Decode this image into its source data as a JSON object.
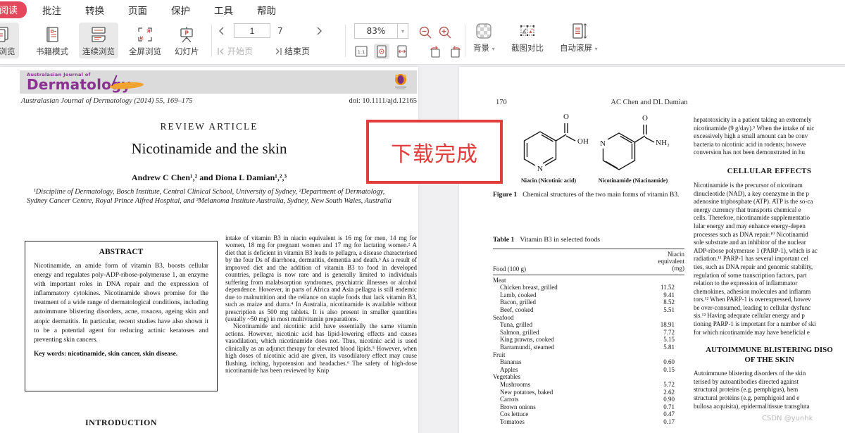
{
  "menu": {
    "active_tab": "阅读",
    "items": [
      "批注",
      "转换",
      "页面",
      "保护",
      "工具",
      "帮助"
    ]
  },
  "toolbar": {
    "view_buttons": [
      {
        "label": "页浏览"
      },
      {
        "label": "书籍模式"
      },
      {
        "label": "连续浏览"
      },
      {
        "label": "全屏浏览"
      },
      {
        "label": "幻灯片"
      }
    ],
    "nav": {
      "current_page": "1",
      "total_pages": "7",
      "start_label": "开始页",
      "end_label": "结束页"
    },
    "zoom": {
      "level": "83%",
      "one_to_one": "1:1"
    },
    "background_label": "背景",
    "compare_label": "截图对比",
    "autoscroll_label": "自动滚屏"
  },
  "overlay": {
    "text": "下载完成"
  },
  "left_page": {
    "banner": {
      "small": "Australasian Journal of",
      "name": "Dermatology"
    },
    "citation": "Australasian Journal of Dermatology (2014) 55, 169–175",
    "doi": "doi: 10.1111/ajd.12165",
    "article_type": "REVIEW ARTICLE",
    "title": "Nicotinamide and the skin",
    "authors": "Andrew C Chen¹,² and Diona L Damian¹,²,³",
    "affiliations": "¹Discipline of Dermatology, Bosch Institute, Central Clinical School, University of Sydney, ²Department of Dermatology, Sydney Cancer Centre, Royal Prince Alfred Hospital, and ³Melanoma Institute Australia, Sydney, New South Wales, Australia",
    "abstract": {
      "heading": "ABSTRACT",
      "text": "Nicotinamide, an amide form of vitamin B3, boosts cellular energy and regulates poly-ADP-ribose-polymerase 1, an enzyme with important roles in DNA repair and the expression of inflammatory cytokines. Nicotinamide shows promise for the treatment of a wide range of dermatological conditions, including autoimmune blistering disorders, acne, rosacea, ageing skin and atopic dermatitis. In particular, recent studies have also shown it to be a potential agent for reducing actinic keratoses and preventing skin cancers.",
      "keywords": "Key words: nicotinamide, skin cancer, skin disease."
    },
    "intro_heading": "INTRODUCTION",
    "col2_para1": "intake of vitamin B3 in niacin equivalent is 16 mg for men, 14 mg for women, 18 mg for pregnant women and 17 mg for lactating women.² A diet that is deficient in vitamin B3 leads to pellagra, a disease characterised by the four Ds of diarrhoea, dermatitis, dementia and death.³ As a result of improved diet and the addition of vitamin B3 to food in developed countries, pellagra is now rare and is generally limited to individuals suffering from malabsorption syndromes, psychiatric illnesses or alcohol dependence. However, in parts of Africa and Asia pellagra is still endemic due to malnutrition and the reliance on staple foods that lack vitamin B3, such as maize and durra.⁴ In Australia, nicotinamide is available without prescription as 500 mg tablets. It is also present in smaller quantities (usually ~50 mg) in most multivitamin preparations.",
    "col2_para2": "Nicotinamide and nicotinic acid have essentially the same vitamin actions. However, nicotinic acid has lipid-lowering effects and causes vasodilation, which nicotinamide does not. Thus, nicotinic acid is used clinically as an adjunct therapy for elevated blood lipids.⁵ However, when high doses of nicotinic acid are given, its vasodilatory effect may cause flushing, itching, hypotension and headaches.⁶ The safety of high-dose nicotinamide has been reviewed by Knip"
  },
  "right_page": {
    "page_number": "170",
    "running_head": "AC Chen and DL Damian",
    "figure": {
      "atoms": {
        "o1": "O",
        "oh": "OH",
        "n1": "N",
        "o2": "O",
        "nh2": "NH₂",
        "n2": "N"
      },
      "mol1_label": "Niacin (Nicotinic acid)",
      "mol2_label": "Nicotinamide (Niacinamide)",
      "caption_label": "Figure 1",
      "caption_text": "Chemical structures of the two main forms of vitamin B3."
    },
    "table": {
      "label": "Table 1",
      "title": "Vitamin B3 in selected foods",
      "col_food": "Food (100 g)",
      "col_value_l1": "Niacin",
      "col_value_l2": "equivalent",
      "col_value_l3": "(mg)",
      "rows": [
        {
          "name": "Meat",
          "value": "",
          "group": true
        },
        {
          "name": "Chicken breast, grilled",
          "value": "11.52"
        },
        {
          "name": "Lamb, cooked",
          "value": "9.41"
        },
        {
          "name": "Bacon, grilled",
          "value": "8.52"
        },
        {
          "name": "Beef, cooked",
          "value": "5.51"
        },
        {
          "name": "Seafood",
          "value": "",
          "group": true
        },
        {
          "name": "Tuna, grilled",
          "value": "18.91"
        },
        {
          "name": "Salmon, grilled",
          "value": "7.72"
        },
        {
          "name": "King prawns, cooked",
          "value": "5.15"
        },
        {
          "name": "Barramundi, steamed",
          "value": "5.81"
        },
        {
          "name": "Fruit",
          "value": "",
          "group": true
        },
        {
          "name": "Bananas",
          "value": "0.60"
        },
        {
          "name": "Apples",
          "value": "0.15"
        },
        {
          "name": "Vegetables",
          "value": "",
          "group": true
        },
        {
          "name": "Mushrooms",
          "value": "5.72"
        },
        {
          "name": "New potatoes, baked",
          "value": "2.62"
        },
        {
          "name": "Carrots",
          "value": "0.90"
        },
        {
          "name": "Brown onions",
          "value": "0.71"
        },
        {
          "name": "Cos lettuce",
          "value": "0.47"
        },
        {
          "name": "Tomatoes",
          "value": "0.17"
        }
      ]
    },
    "col2": {
      "para1_lines": [
        "hepatotoxicity in a patient taking an extremely",
        "nicotinamide (9 g/day).⁹ When the intake of nic",
        "excessively high a small amount can be conv",
        "bacteria to nicotinic acid in rodents; howeve",
        "conversion has not been demonstrated in hu"
      ],
      "heading1": "CELLULAR EFFECTS",
      "para2_lines": [
        "Nicotinamide is the precursor of nicotinam",
        "dinucleotide (NAD), a key coenzyme in the p",
        "adenosine triphosphate (ATP). ATP is the so-ca",
        "energy currency that transports chemical e",
        "cells. Therefore, nicotinamide supplementatio",
        "lular energy and may enhance energy-depen",
        "processes such as DNA repair.¹⁰ Nicotinamid",
        "sole substrate and an inhibitor of the nuclear",
        "ADP-ribose polymerase 1 (PARP-1), which is ac",
        "radiation.¹¹ PARP-1 has several important cel",
        "ties, such as DNA repair and genomic stability,",
        "regulation of some transcription factors, part",
        "relation to the expression of inflammator",
        "chemokines, adhesion molecules and inflamm",
        "tors.¹² When PARP-1 is overexpressed, howev",
        "be over-consumed, leading to cellular dysfunc",
        "sis.¹² Having adequate cellular energy and p",
        "tioning PARP-1 is important for a number of ski",
        "for which nicotinamide may have beneficial e"
      ],
      "heading2_line1": "AUTOIMMUNE BLISTERING DISO",
      "heading2_line2": "OF THE SKIN",
      "para3_lines": [
        "Autoimmune blistering disorders of the skin",
        "terised by autoantibodies directed against",
        "structural proteins (e.g. pemphigus), hem",
        "structural proteins (e.g. pemphigoid and e",
        "bullosa acquisita), epidermal/tissue transgluta"
      ]
    },
    "watermark": "CSDN @yunhk"
  }
}
